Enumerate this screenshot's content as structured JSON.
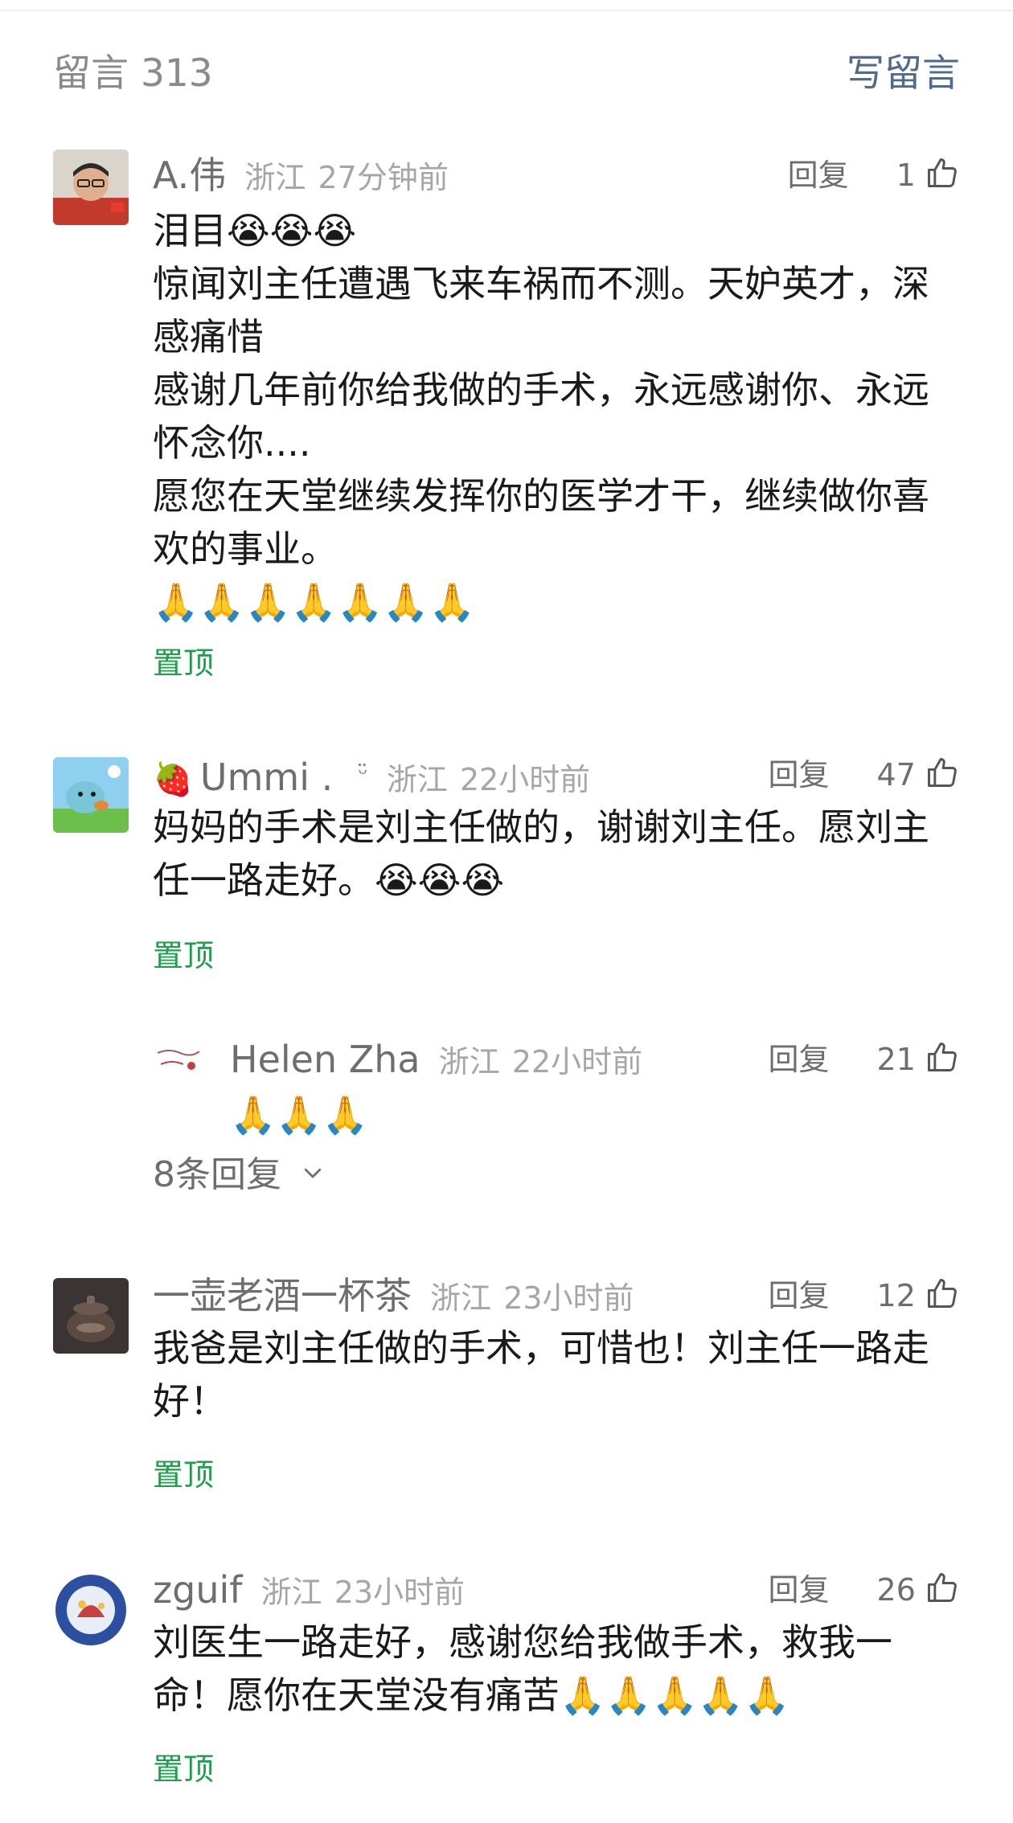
{
  "header": {
    "count_label": "留言 313",
    "write_label": "写留言"
  },
  "comments": [
    {
      "nickname": "A.伟",
      "location": "浙江",
      "time": "27分钟前",
      "reply_label": "回复",
      "likes": "1",
      "lines": [
        "泪目😭😭😭",
        "惊闻刘主任遭遇飞来车祸而不测。天妒英才，深感痛惜",
        "感谢几年前你给我做的手术，永远感谢你、永远怀念你....",
        "愿您在天堂继续发挥你的医学才干，继续做你喜欢的事业。",
        "🙏🙏🙏🙏🙏🙏🙏"
      ],
      "pin_label": "置顶"
    },
    {
      "nickname_icon": "🍓",
      "nickname": "Ummi .",
      "nickname_badge": "ᵕ̈",
      "location": "浙江",
      "time": "22小时前",
      "reply_label": "回复",
      "likes": "47",
      "lines": [
        "妈妈的手术是刘主任做的，谢谢刘主任。愿刘主任一路走好。😭😭😭"
      ],
      "pin_label": "置顶",
      "reply": {
        "nickname": "Helen Zha",
        "location": "浙江",
        "time": "22小时前",
        "reply_label": "回复",
        "likes": "21",
        "text": "🙏🙏🙏"
      },
      "more_replies_label": "8条回复"
    },
    {
      "nickname": "一壶老酒一杯茶",
      "location": "浙江",
      "time": "23小时前",
      "reply_label": "回复",
      "likes": "12",
      "lines": [
        "我爸是刘主任做的手术，可惜也！刘主任一路走好！"
      ],
      "pin_label": "置顶"
    },
    {
      "nickname": "zguif",
      "location": "浙江",
      "time": "23小时前",
      "reply_label": "回复",
      "likes": "26",
      "lines": [
        "刘医生一路走好，感谢您给我做手术，救我一命！愿你在天堂没有痛苦🙏🙏🙏🙏🙏"
      ],
      "pin_label": "置顶"
    }
  ],
  "colors": {
    "pin_green": "#1f9e4b",
    "write_link": "#536b8a",
    "meta_gray": "#a6a6a6"
  }
}
